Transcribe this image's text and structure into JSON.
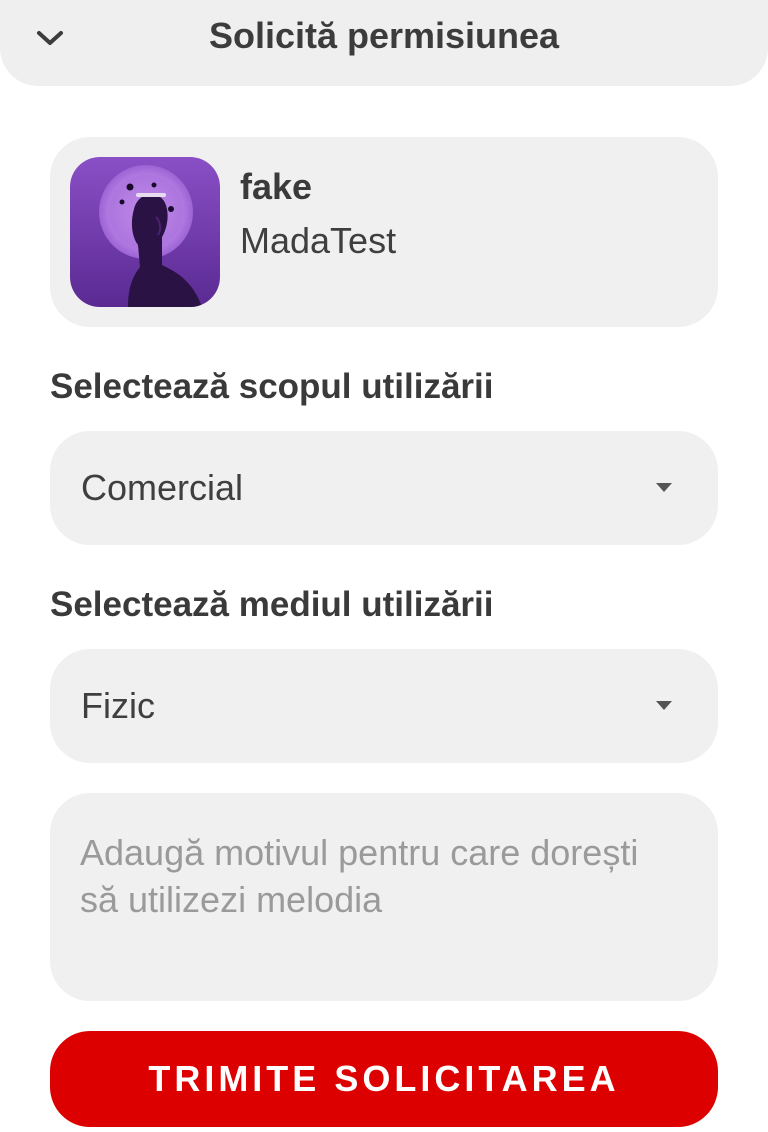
{
  "header": {
    "title": "Solicită permisiunea",
    "collapse_icon": "chevron-down-icon"
  },
  "song": {
    "title": "fake",
    "artist": "MadaTest",
    "cover_icon": "album-cover-image"
  },
  "usage_purpose": {
    "label": "Selectează scopul utilizării",
    "selected": "Comercial"
  },
  "usage_medium": {
    "label": "Selectează mediul utilizării",
    "selected": "Fizic"
  },
  "reason": {
    "placeholder": "Adaugă motivul pentru care dorești să utilizezi melodia",
    "value": ""
  },
  "submit": {
    "label": "TRIMITE SOLICITAREA"
  },
  "colors": {
    "accent": "#dd0000",
    "surface": "#f0f0f0",
    "header_bg": "#efefef",
    "text": "#3c3c3c",
    "placeholder": "#9a9a9a"
  }
}
